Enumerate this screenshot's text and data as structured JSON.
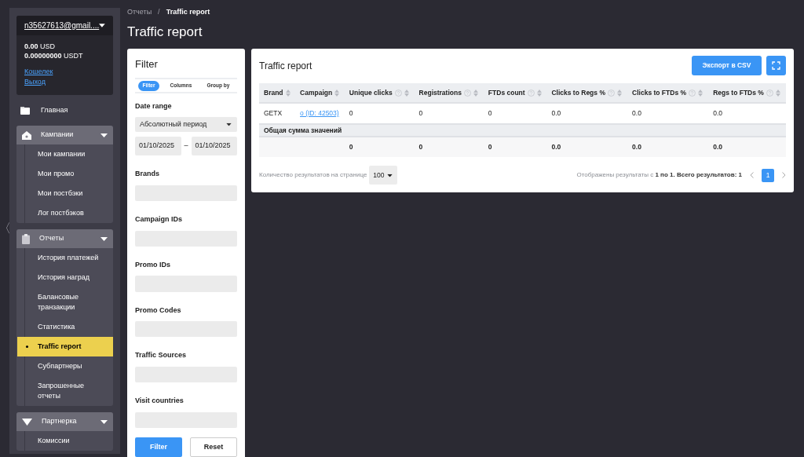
{
  "collapse_handle": "〈",
  "account": {
    "email": "n35627613@gmail....",
    "balances": [
      {
        "amount": "0.00",
        "currency": "USD"
      },
      {
        "amount": "0.00000000",
        "currency": "USDT"
      }
    ],
    "links": [
      "Кошелек",
      "Выход"
    ]
  },
  "sidebar": {
    "items": [
      {
        "kind": "link",
        "label": "Главная",
        "selected": false
      },
      {
        "kind": "group",
        "label": "Кампании",
        "expanded": true,
        "children": [
          {
            "label": "Мои кампании",
            "selected": false
          },
          {
            "label": "Мои промо",
            "selected": false
          },
          {
            "label": "Мои постбэки",
            "selected": false
          },
          {
            "label": "Лог постбэков",
            "selected": false
          }
        ]
      },
      {
        "kind": "group",
        "label": "Отчеты",
        "expanded": true,
        "children": [
          {
            "label": "История платежей",
            "selected": false
          },
          {
            "label": "История наград",
            "selected": false
          },
          {
            "label": "Балансовые транзакции",
            "selected": false
          },
          {
            "label": "Статистика",
            "selected": false
          },
          {
            "label": "Traffic report",
            "selected": true
          },
          {
            "label": "Субпартнеры",
            "selected": false
          },
          {
            "label": "Запрошенные отчеты",
            "selected": false
          }
        ]
      },
      {
        "kind": "group",
        "label": "Партнерка",
        "expanded": true,
        "children": [
          {
            "label": "Комиссии",
            "selected": false
          }
        ]
      }
    ]
  },
  "breadcrumb": {
    "separator": "/",
    "items": [
      "Отчеты",
      "Traffic report"
    ]
  },
  "page_title": "Traffic report",
  "filter": {
    "title": "Filter",
    "tabs": [
      {
        "label": "Filter",
        "selected": true
      },
      {
        "label": "Columns",
        "selected": false
      },
      {
        "label": "Group by",
        "selected": false
      }
    ],
    "date_range": {
      "label": "Date range",
      "mode": "Абсолютный период",
      "from": "01/10/2025",
      "separator": "–",
      "to": "01/10/2025"
    },
    "fields": [
      "Brands",
      "Campaign IDs",
      "Promo IDs",
      "Promo Codes",
      "Traffic Sources",
      "Visit countries"
    ],
    "buttons": [
      {
        "label": "Filter",
        "kind": "primary"
      },
      {
        "label": "Reset",
        "kind": "secondary"
      }
    ]
  },
  "report": {
    "title": "Traffic report",
    "export_button": "Экспорт в CSV",
    "table": {
      "columns": [
        {
          "label": "Brand",
          "help": false
        },
        {
          "label": "Campaign",
          "help": false
        },
        {
          "label": "Unique clicks",
          "help": true
        },
        {
          "label": "Registrations",
          "help": true
        },
        {
          "label": "FTDs count",
          "help": true
        },
        {
          "label": "Clicks to Regs %",
          "help": true
        },
        {
          "label": "Clicks to FTDs %",
          "help": true
        },
        {
          "label": "Regs to FTDs %",
          "help": true
        }
      ],
      "rows": [
        {
          "cells": [
            {
              "kind": "text",
              "text": "GETX"
            },
            {
              "kind": "link",
              "text": "o (ID: 42503)"
            },
            {
              "kind": "text",
              "text": "0"
            },
            {
              "kind": "text",
              "text": "0"
            },
            {
              "kind": "text",
              "text": "0"
            },
            {
              "kind": "text",
              "text": "0.0"
            },
            {
              "kind": "text",
              "text": "0.0"
            },
            {
              "kind": "text",
              "text": "0.0"
            }
          ]
        }
      ],
      "total_label": "Общая сумма значений",
      "totals": [
        "0",
        "0",
        "0",
        "0.0",
        "0.0",
        "0.0"
      ]
    },
    "page_size_label": "Количество результатов на странице",
    "page_size": "100",
    "results_text": "Отображены результаты с **1 по 1. Всего результатов: 1**",
    "pages": [
      {
        "label": "1",
        "selected": true
      }
    ]
  }
}
